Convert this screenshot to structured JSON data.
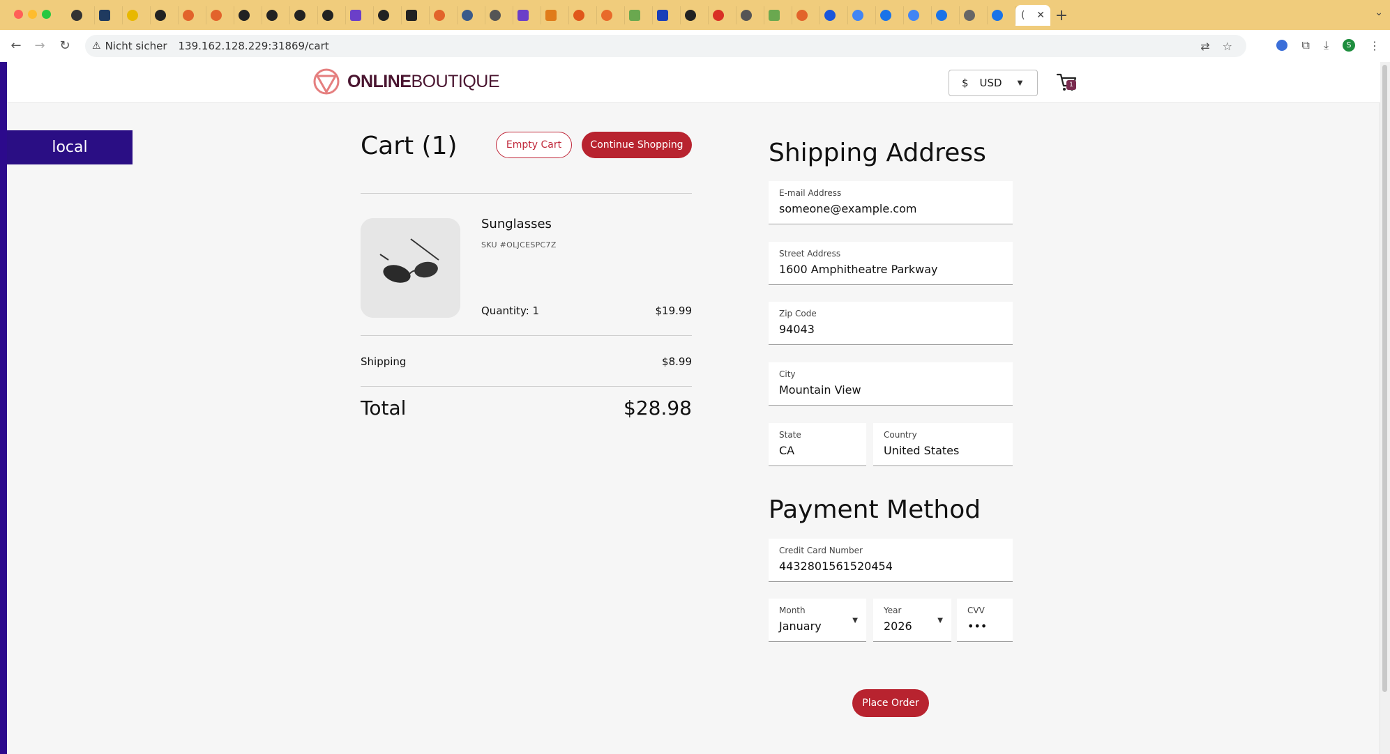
{
  "browser": {
    "active_tab_letter": "(",
    "new_tab": "+",
    "security_label": "Nicht sicher",
    "url": "139.162.128.229:31869/cart",
    "profile_initial": "S"
  },
  "header": {
    "logo_bold": "ONLINE",
    "logo_thin": "BOUTIQUE",
    "currency_symbol": "$",
    "currency_code": "USD",
    "cart_count": "1"
  },
  "env_badge": "local",
  "cart": {
    "title": "Cart (1)",
    "empty_button": "Empty Cart",
    "continue_button": "Continue Shopping",
    "items": [
      {
        "name": "Sunglasses",
        "sku": "SKU #OLJCESPC7Z",
        "quantity": "Quantity: 1",
        "price": "$19.99"
      }
    ],
    "shipping_label": "Shipping",
    "shipping_value": "$8.99",
    "total_label": "Total",
    "total_value": "$28.98"
  },
  "shipping": {
    "title": "Shipping Address",
    "email_label": "E-mail Address",
    "email_value": "someone@example.com",
    "street_label": "Street Address",
    "street_value": "1600 Amphitheatre Parkway",
    "zip_label": "Zip Code",
    "zip_value": "94043",
    "city_label": "City",
    "city_value": "Mountain View",
    "state_label": "State",
    "state_value": "CA",
    "country_label": "Country",
    "country_value": "United States"
  },
  "payment": {
    "title": "Payment Method",
    "card_label": "Credit Card Number",
    "card_value": "4432801561520454",
    "month_label": "Month",
    "month_value": "January",
    "year_label": "Year",
    "year_value": "2026",
    "cvv_label": "CVV",
    "cvv_value": "•••",
    "place_order": "Place Order"
  },
  "colors": {
    "accent": "#b8232f",
    "env_badge": "#2a0e84",
    "logo": "#4a1530"
  }
}
